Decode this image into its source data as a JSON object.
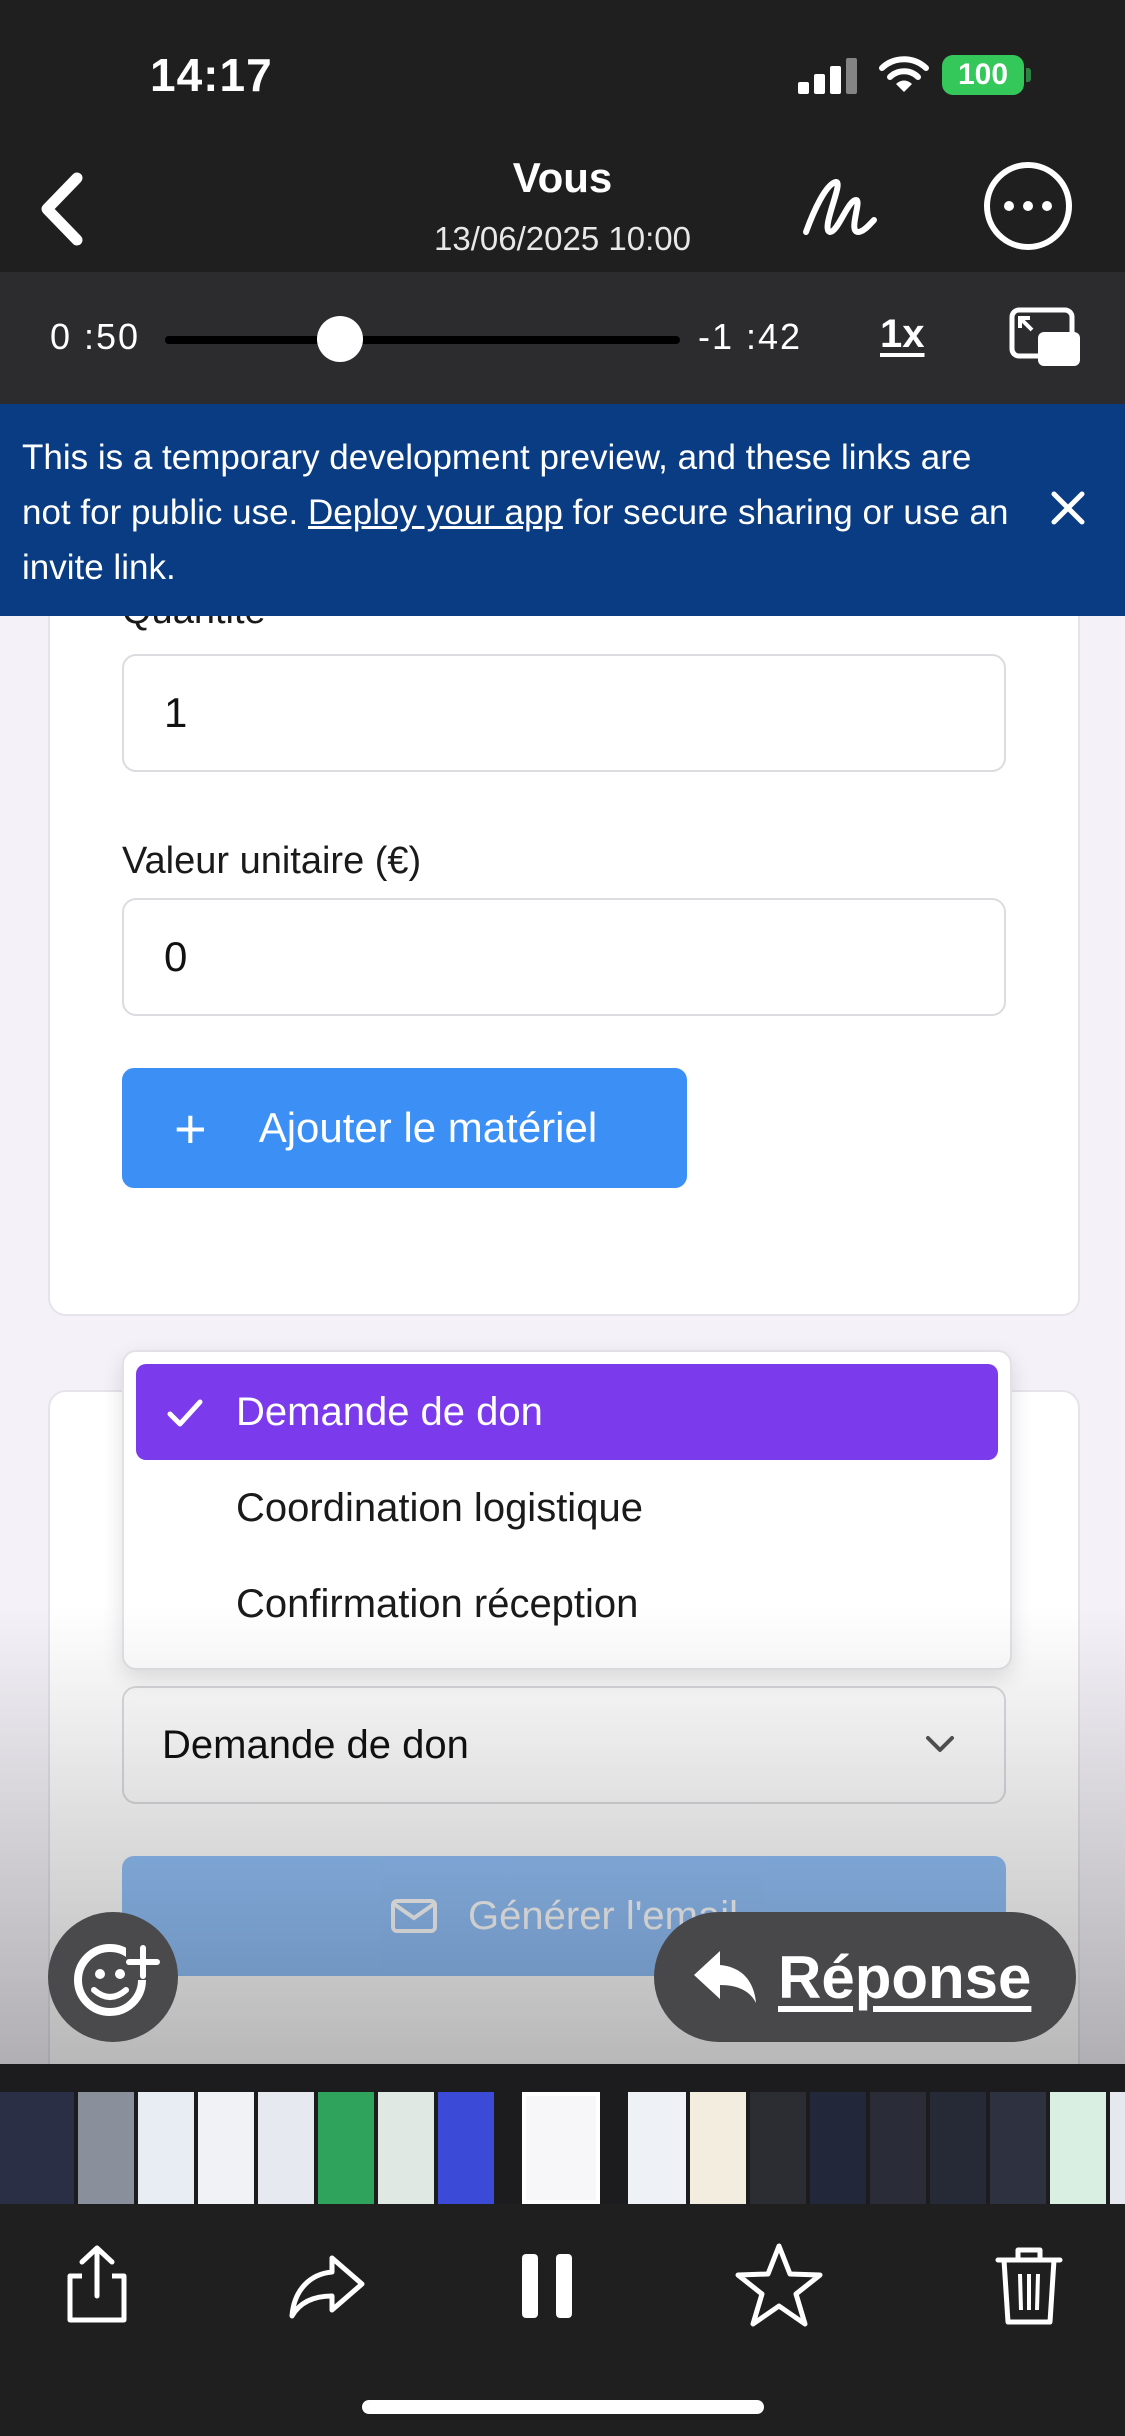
{
  "status_bar": {
    "time": "14:17",
    "battery": "100"
  },
  "header": {
    "title": "Vous",
    "subtitle": "13/06/2025 10:00"
  },
  "playback": {
    "elapsed": "0 :50",
    "remaining": "-1 :42",
    "speed": "1x",
    "progress": 0.34
  },
  "banner": {
    "text_before": "This is a temporary development preview, and these links are not for public use. ",
    "link": "Deploy your app",
    "text_after": " for secure sharing or use an invite link."
  },
  "form": {
    "quantity_label": "Quantité",
    "quantity_value": "1",
    "unit_value_label": "Valeur unitaire (€)",
    "unit_value_value": "0",
    "add_button": "Ajouter le matériel",
    "email_type_selected": "Demande de don",
    "email_type_options": [
      "Demande de don",
      "Coordination logistique",
      "Confirmation réception"
    ],
    "generate_button": "Générer l'email"
  },
  "reply": {
    "label": "Réponse"
  },
  "colors": {
    "banner": "#0a3c84",
    "primary_button": "#3b8ff5",
    "selected_option": "#7c3aed",
    "battery": "#34c759"
  },
  "icons": [
    "back-chevron-icon",
    "markup-icon",
    "more-icon",
    "pip-icon",
    "close-icon",
    "plus-icon",
    "check-icon",
    "chevron-down-icon",
    "mail-icon",
    "emoji-add-icon",
    "reply-arrow-icon",
    "share-icon",
    "forward-icon",
    "pause-icon",
    "star-icon",
    "trash-icon"
  ]
}
